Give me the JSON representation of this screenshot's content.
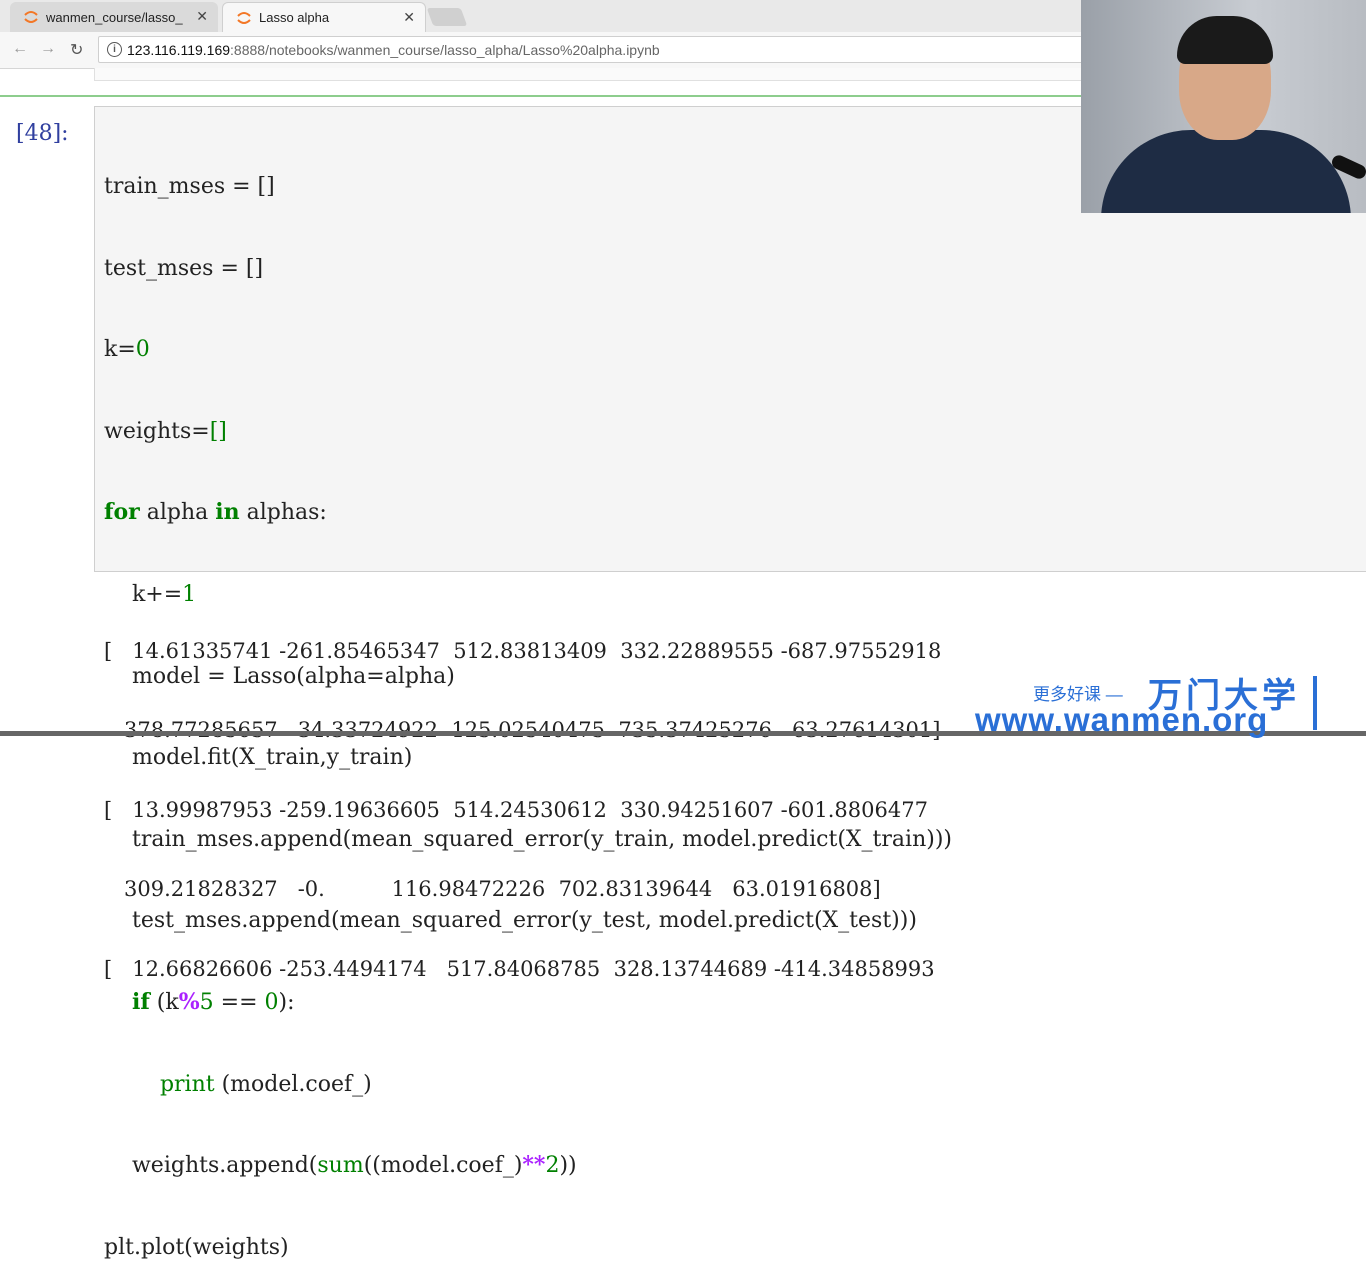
{
  "browser": {
    "tabs": [
      {
        "title": "wanmen_course/lasso_",
        "active": false
      },
      {
        "title": "Lasso alpha",
        "active": true
      }
    ],
    "url_host": "123.116.119.169",
    "url_path": ":8888/notebooks/wanmen_course/lasso_alpha/Lasso%20alpha.ipynb"
  },
  "notebook": {
    "prompt": "[48]:",
    "code_lines": [
      "train_mses = []",
      "test_mses = []",
      "k=0",
      "weights=[]",
      "for alpha in alphas:",
      "    k+=1",
      "    model = Lasso(alpha=alpha)",
      "    model.fit(X_train,y_train)",
      "    train_mses.append(mean_squared_error(y_train, model.predict(X_train)))",
      "    test_mses.append(mean_squared_error(y_test, model.predict(X_test)))",
      "    if (k%5 == 0):",
      "        print (model.coef_)",
      "    weights.append(sum((model.coef_)**2))",
      "plt.plot(weights)"
    ],
    "output_lines": [
      "[   14.61335741 -261.85465347  512.83813409  332.22889555 -687.97552918",
      "   378.77285657   34.33724922  125.02540475  735.37425276   63.27614301]",
      "[   13.99987953 -259.19636605  514.24530612  330.94251607 -601.8806477",
      "   309.21828327   -0.          116.98472226  702.83139644   63.01916808]",
      "[   12.66826606 -253.4494174   517.84068785  328.13744689 -414.34858993"
    ]
  },
  "watermark": {
    "slogan": "更多好课 —",
    "brand": "万门大学",
    "site": "www.wanmen.org",
    "color": "#2a6fd6"
  }
}
